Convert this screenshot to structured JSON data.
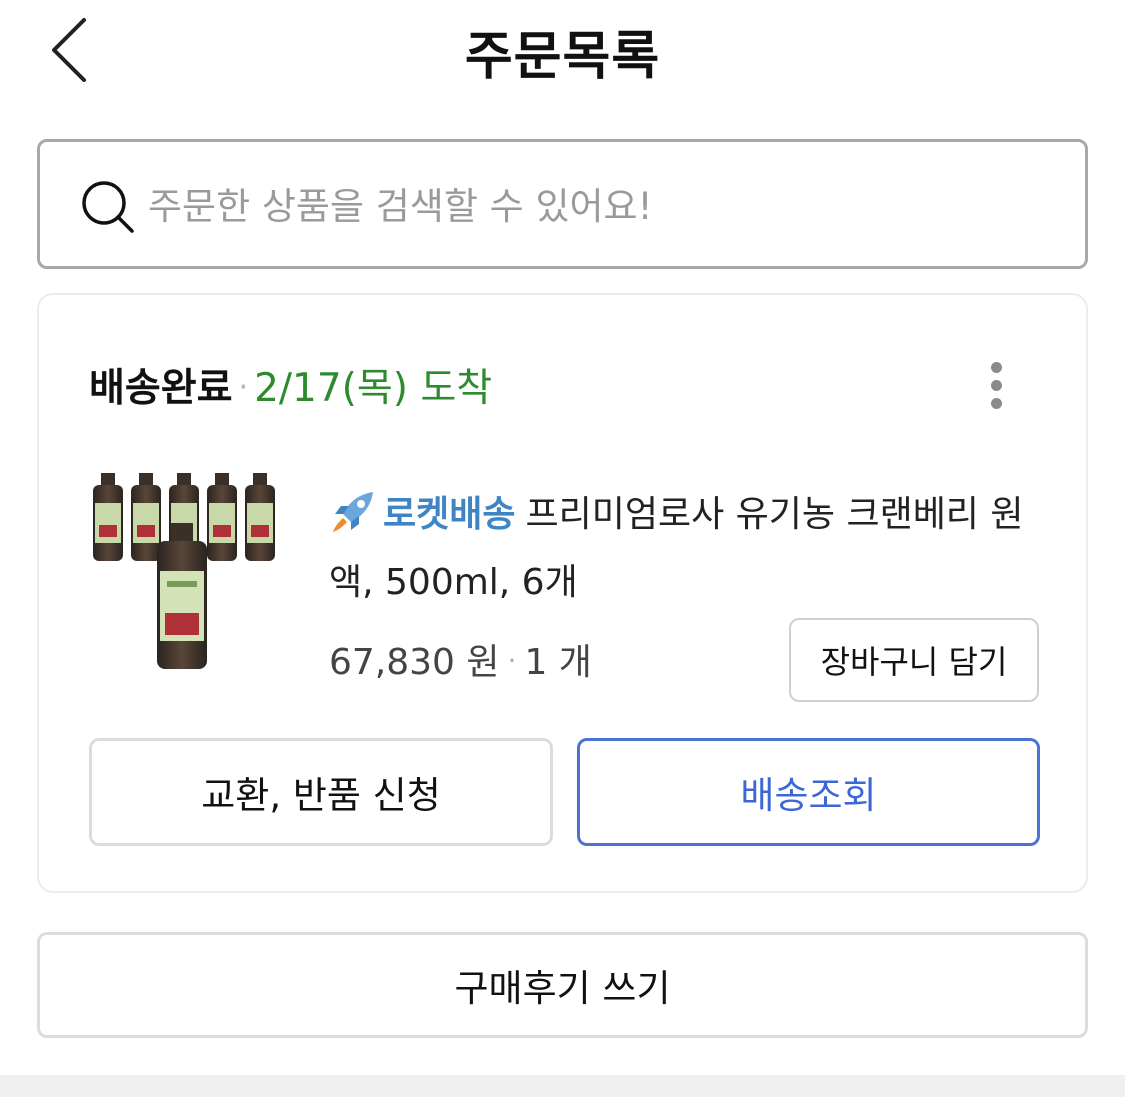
{
  "header": {
    "title": "주문목록",
    "back_icon": "chevron-left-icon"
  },
  "search": {
    "icon": "search-icon",
    "placeholder": "주문한 상품을 검색할 수 있어요!",
    "value": ""
  },
  "order": {
    "status": "배송완료",
    "separator": "·",
    "arrival": "2/17(목) 도착",
    "menu_icon": "more-vertical-icon",
    "colors": {
      "arrival": "#2e8a2e",
      "rocket": "#3f84c4",
      "track_button": "#3d67d2"
    },
    "product": {
      "image_icon": "juice-bottles-image",
      "badge_icon": "rocket-icon",
      "badge_label": "로켓배송",
      "name": "프리미엄로사 유기농 크랜베리 원액, 500ml, 6개",
      "price": "67,830 원",
      "separator": "·",
      "quantity": "1 개",
      "cart_button": "장바구니 담기"
    },
    "actions": {
      "exchange": "교환, 반품 신청",
      "track": "배송조회"
    }
  },
  "review_button": "구매후기 쓰기"
}
